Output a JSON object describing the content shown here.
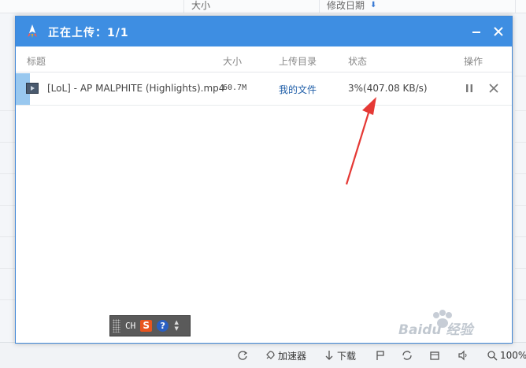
{
  "background": {
    "columns": {
      "size": "大小",
      "modified": "修改日期",
      "sort_arrow": "⬇"
    }
  },
  "dialog": {
    "title": "正在上传：1/1",
    "minimize_icon": "minimize-icon",
    "close_icon": "close-icon",
    "headers": {
      "title": "标题",
      "size": "大小",
      "dir": "上传目录",
      "status": "状态",
      "action": "操作"
    },
    "rows": [
      {
        "name": "[LoL] - AP MALPHITE (Highlights).mp4",
        "size": "60.7M",
        "dir": "我的文件",
        "status": "3%(407.08 KB/s)"
      }
    ]
  },
  "ime": {
    "mode": "CH",
    "brand": "S",
    "help": "?"
  },
  "statusbar": {
    "accelerator": "加速器",
    "download": "下载",
    "zoom": "100%"
  },
  "watermark": {
    "text": "Baidu 经验"
  },
  "colors": {
    "titlebar": "#3e8ee2",
    "link": "#1f5ea8",
    "arrow": "#e53935",
    "accent_row": "#99c8ef"
  }
}
